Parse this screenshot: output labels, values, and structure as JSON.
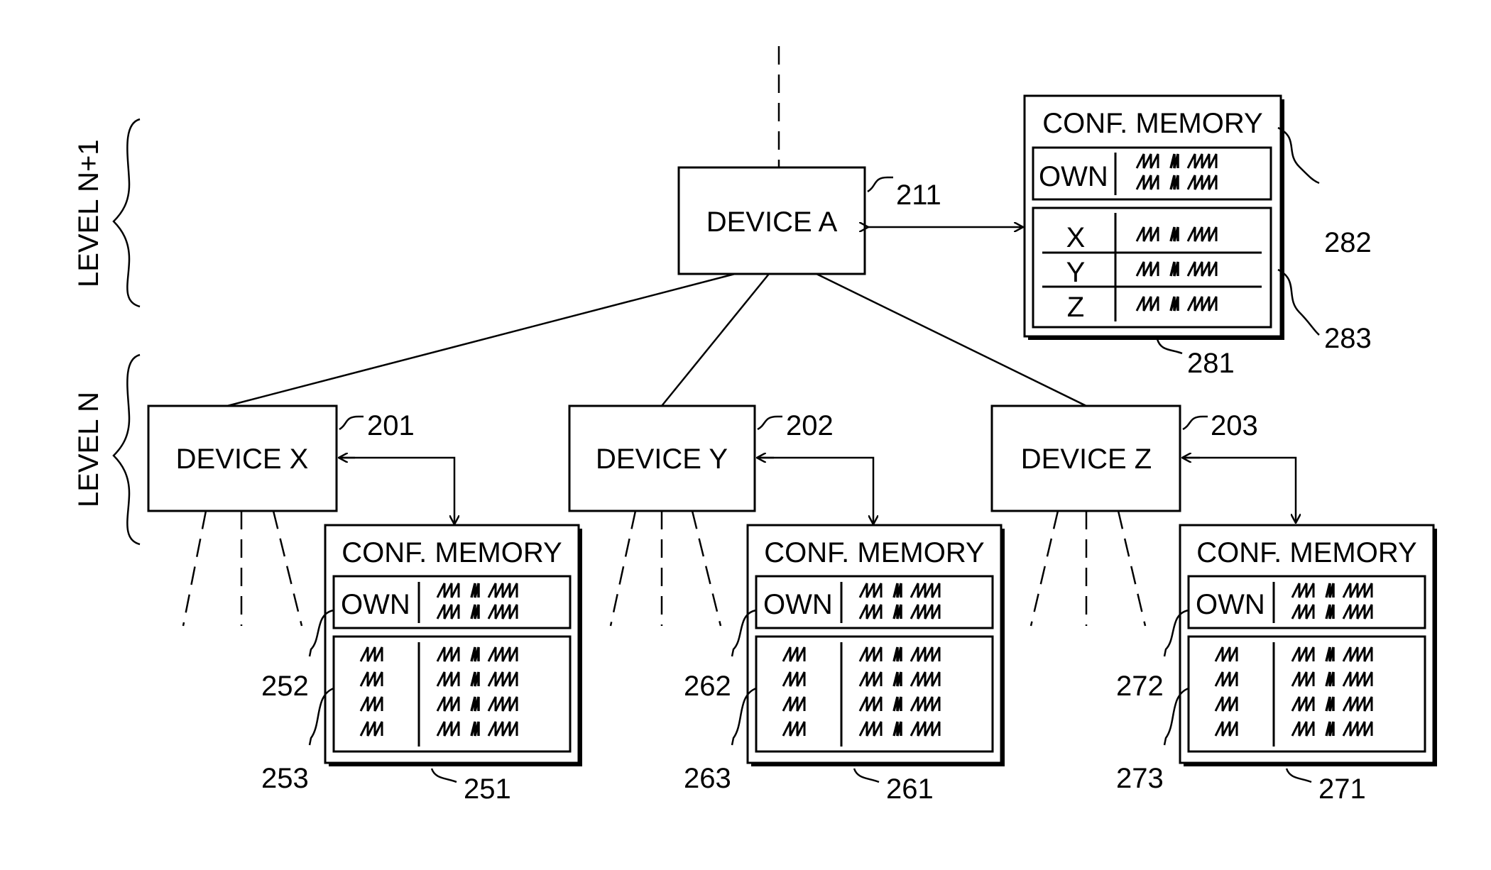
{
  "levels": {
    "upper": "LEVEL N+1",
    "lower": "LEVEL N"
  },
  "devices": {
    "a": {
      "label": "DEVICE A",
      "ref": "211"
    },
    "x": {
      "label": "DEVICE X",
      "ref": "201"
    },
    "y": {
      "label": "DEVICE Y",
      "ref": "202"
    },
    "z": {
      "label": "DEVICE Z",
      "ref": "203"
    }
  },
  "memories": {
    "top": {
      "title": "CONF. MEMORY",
      "ref": "281",
      "own_ref": "282",
      "table_ref": "283",
      "own_label": "OWN",
      "rows": [
        "X",
        "Y",
        "Z"
      ]
    },
    "x": {
      "title": "CONF. MEMORY",
      "ref": "251",
      "own_ref": "252",
      "table_ref": "253",
      "own_label": "OWN"
    },
    "y": {
      "title": "CONF. MEMORY",
      "ref": "261",
      "own_ref": "262",
      "table_ref": "263",
      "own_label": "OWN"
    },
    "z": {
      "title": "CONF. MEMORY",
      "ref": "271",
      "own_ref": "272",
      "table_ref": "273",
      "own_label": "OWN"
    }
  },
  "placeholder_glyphs": {
    "short": "ꟿꟿꟿ",
    "mid": "ꟿ",
    "long": "ꟿꟿꟿꟿ"
  }
}
